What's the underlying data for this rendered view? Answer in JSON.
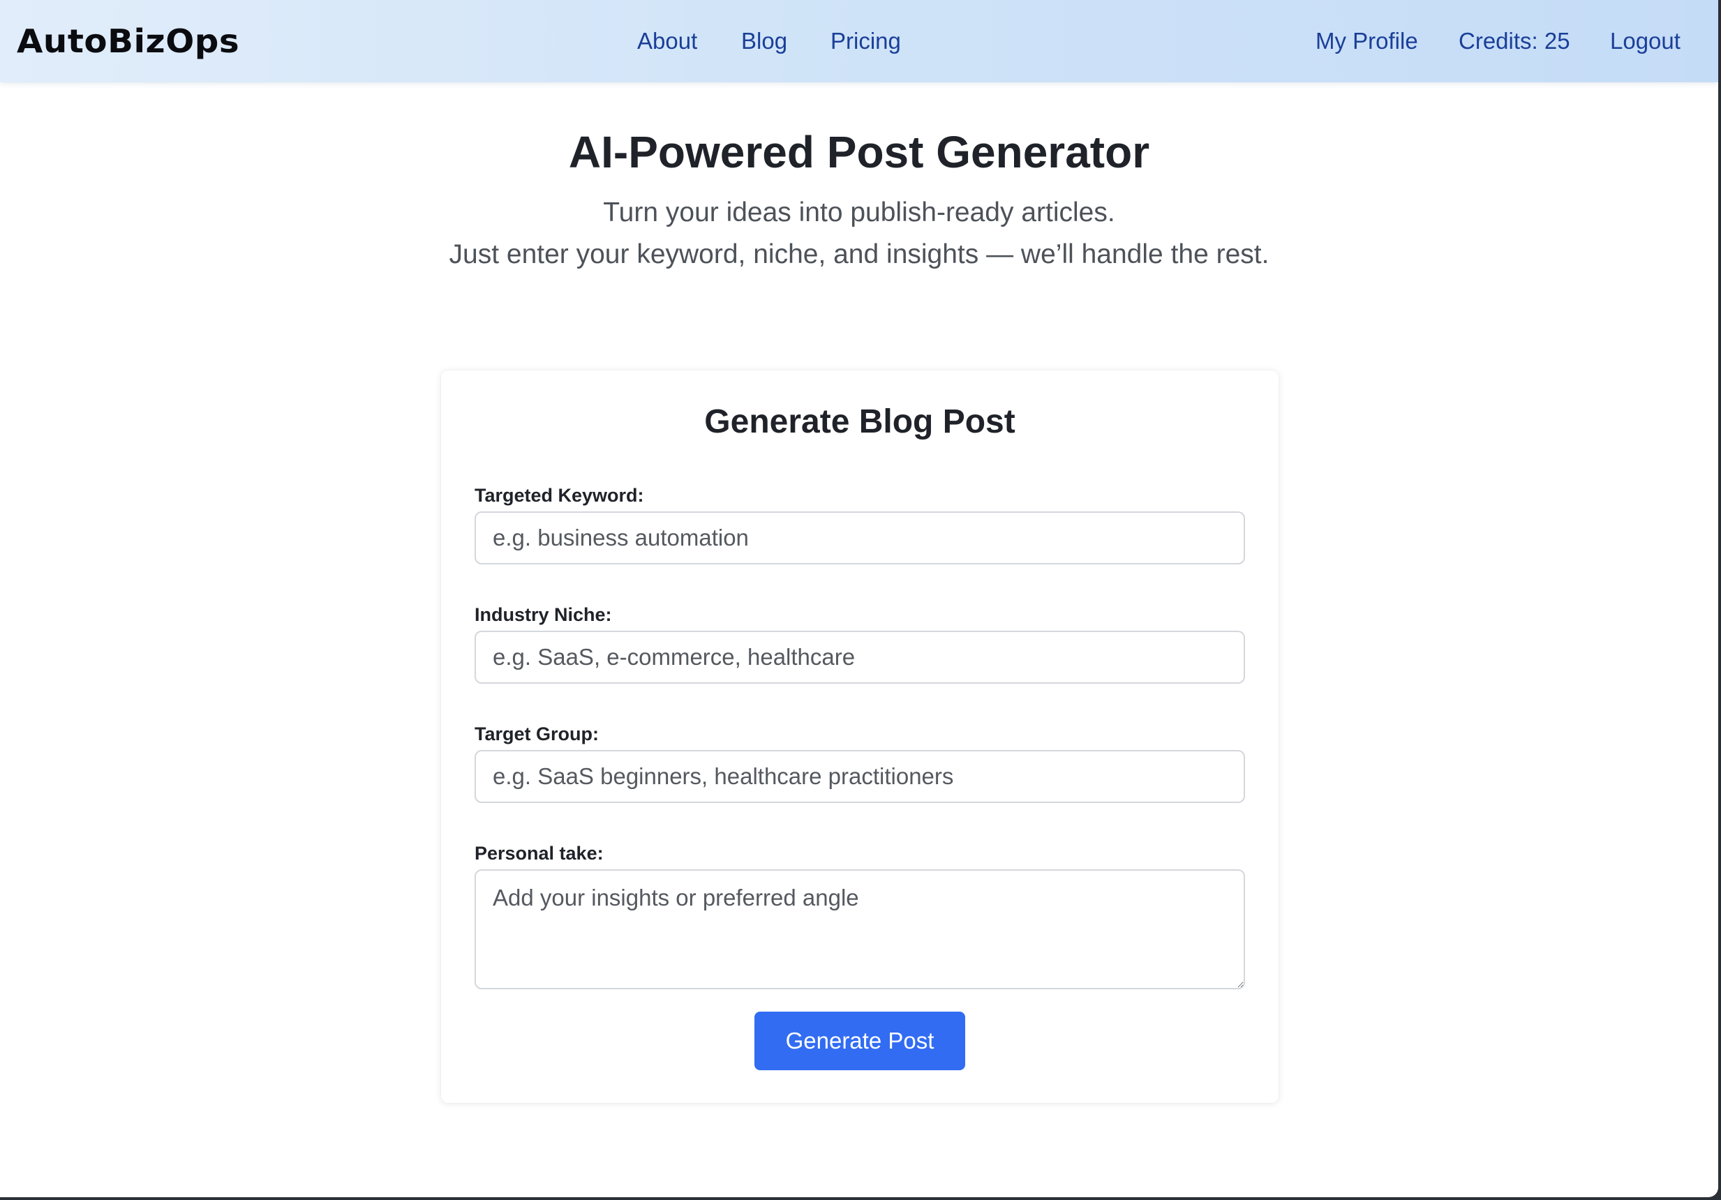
{
  "navbar": {
    "logo": "AutoBizOps",
    "links": {
      "about": "About",
      "blog": "Blog",
      "pricing": "Pricing"
    },
    "account": {
      "profile": "My Profile",
      "credits": "Credits: 25",
      "logout": "Logout"
    }
  },
  "hero": {
    "title": "AI-Powered Post Generator",
    "subtitle_line1": "Turn your ideas into publish-ready articles.",
    "subtitle_line2": "Just enter your keyword, niche, and insights — we’ll handle the rest."
  },
  "form": {
    "title": "Generate Blog Post",
    "keyword": {
      "label": "Targeted Keyword:",
      "value": "",
      "placeholder": "e.g. business automation"
    },
    "niche": {
      "label": "Industry Niche:",
      "value": "",
      "placeholder": "e.g. SaaS, e-commerce, healthcare"
    },
    "target_group": {
      "label": "Target Group:",
      "value": "",
      "placeholder": "e.g. SaaS beginners, healthcare practitioners"
    },
    "personal_take": {
      "label": "Personal take:",
      "value": "",
      "placeholder": "Add your insights or preferred angle"
    },
    "submit_label": "Generate Post"
  },
  "colors": {
    "nav_link": "#1a3f98",
    "nav_gradient_start": "#e1edfa",
    "nav_gradient_end": "#c5dcf7",
    "primary_button": "#316cf3",
    "heading": "#1f2329"
  }
}
